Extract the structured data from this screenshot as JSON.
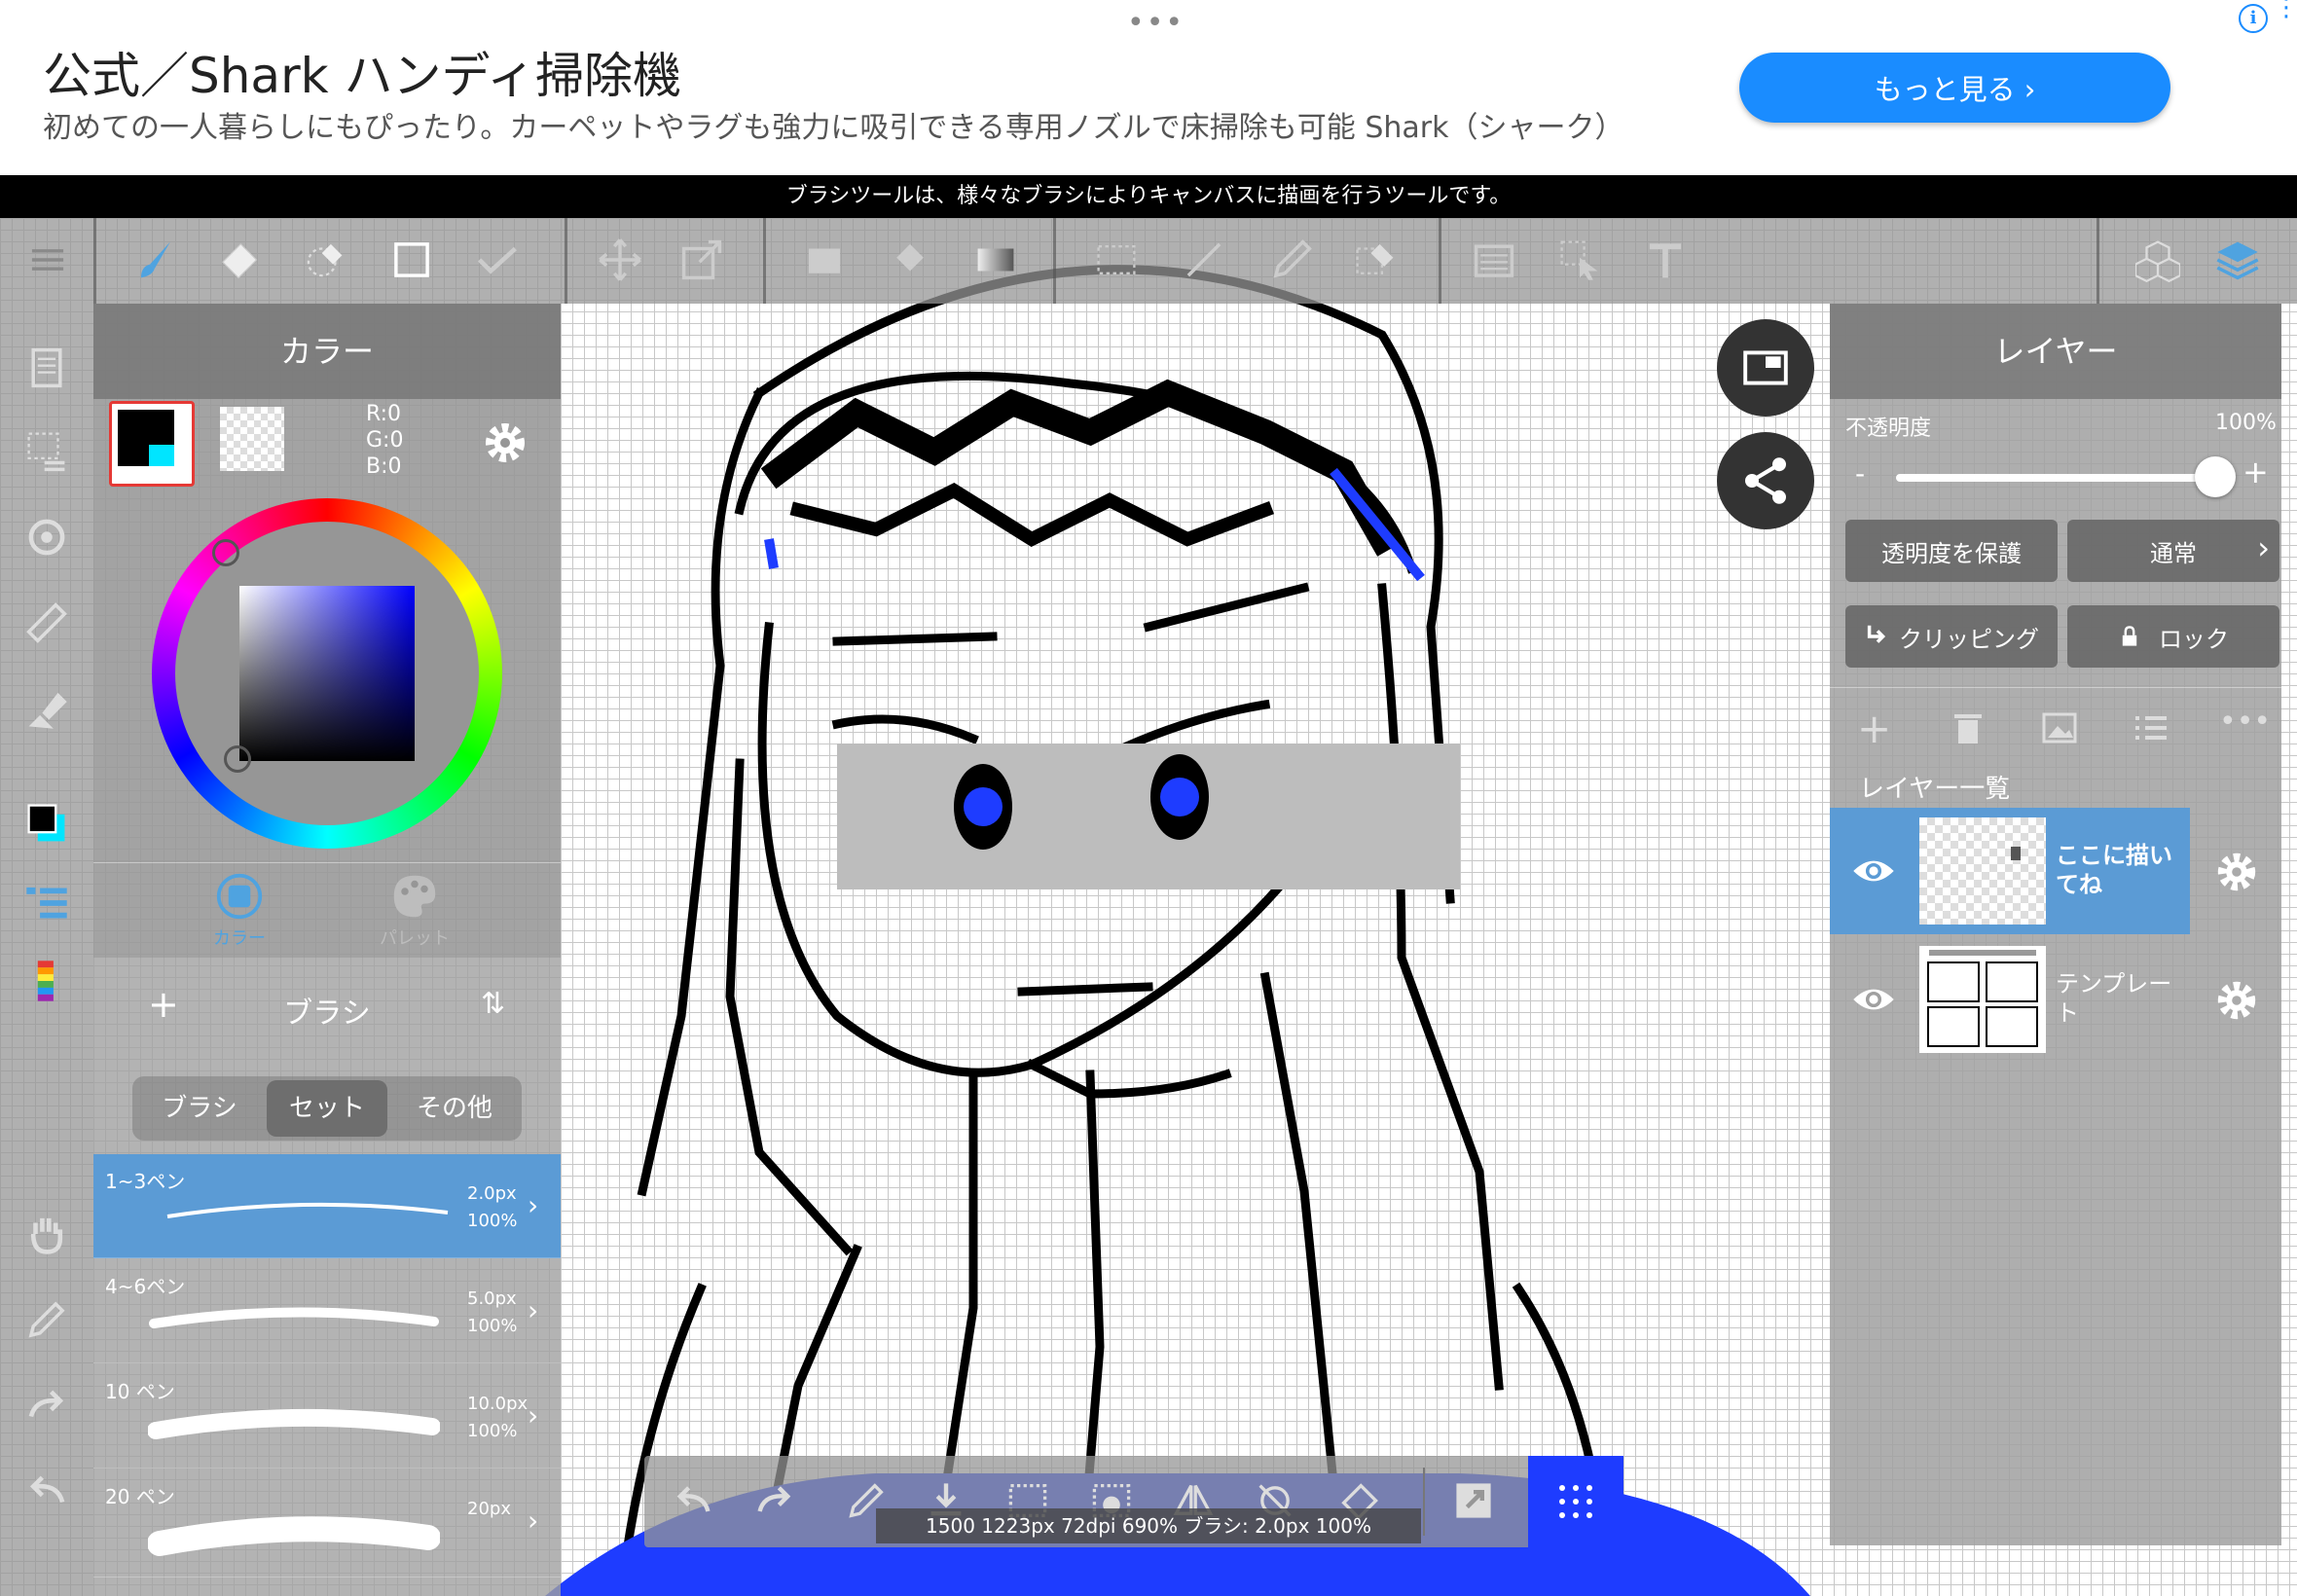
{
  "ad": {
    "title": "公式／Shark ハンディ掃除機",
    "description": "初めての一人暮らしにもぴったり。カーペットやラグも強力に吸引できる専用ノズルで床掃除も可能 Shark（シャーク）",
    "button_label": "もっと見る ›",
    "dots": "•••",
    "info": "i",
    "kebab": "⋮"
  },
  "tooltip": "ブラシツールは、様々なブラシによりキャンバスに描画を行うツールです。",
  "colors": {
    "accent": "#5b9bd5",
    "primary": "#000000",
    "secondary": "#00e5ff",
    "highlight": "#e53935"
  },
  "color_panel": {
    "title": "カラー",
    "rgb": {
      "r": "R:0",
      "g": "G:0",
      "b": "B:0"
    },
    "tabs": [
      {
        "label": "カラー",
        "active": true
      },
      {
        "label": "パレット",
        "active": false
      }
    ]
  },
  "brush_panel": {
    "title": "ブラシ",
    "add": "+",
    "sort": "⇅",
    "segments": [
      "ブラシ",
      "セット",
      "その他"
    ],
    "active_segment": 1,
    "brushes": [
      {
        "name": "1~3ペン",
        "size": "2.0px",
        "opacity": "100%",
        "selected": true
      },
      {
        "name": "4~6ペン",
        "size": "5.0px",
        "opacity": "100%",
        "selected": false
      },
      {
        "name": "10 ペン",
        "size": "10.0px",
        "opacity": "100%",
        "selected": false
      },
      {
        "name": "20 ペン",
        "size": "20px",
        "opacity": "",
        "selected": false
      }
    ]
  },
  "layer_panel": {
    "title": "レイヤー",
    "opacity_label": "不透明度",
    "opacity_value": "100%",
    "opacity_fraction": 1.0,
    "minus": "-",
    "plus": "+",
    "protect_alpha": "透明度を保護",
    "blend_mode": "通常",
    "clipping": "クリッピング",
    "lock": "ロック",
    "list_title": "レイヤー一覧",
    "layers": [
      {
        "name": "ここに描いてね",
        "selected": true
      },
      {
        "name": "テンプレート",
        "selected": false
      }
    ]
  },
  "status_bar": "1500 1223px 72dpi 690% ブラシ: 2.0px 100%"
}
